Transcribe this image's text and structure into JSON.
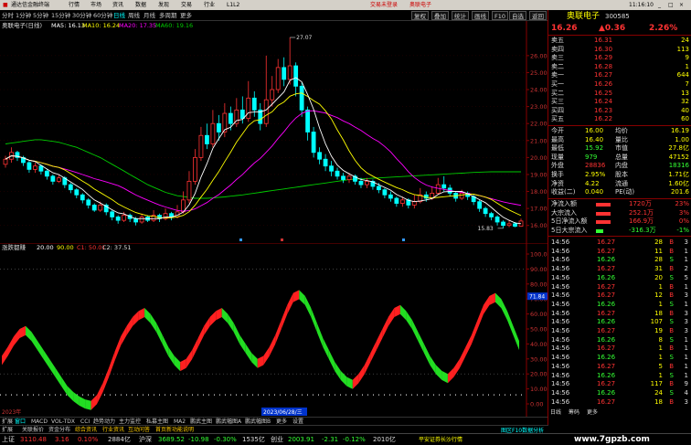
{
  "app": {
    "title": "通达信金融终端",
    "menus": [
      "行情",
      "市场",
      "资讯",
      "数据",
      "发现",
      "交易",
      "行业",
      "L1L2"
    ],
    "notice": "交易未登录",
    "stock_tag": "奥联电子",
    "clock": "11:16:10",
    "window_controls": [
      "_",
      "□",
      "×"
    ]
  },
  "toolbar": {
    "periods": [
      "分时",
      "1分钟",
      "5分钟",
      "15分钟",
      "30分钟",
      "60分钟",
      "日线",
      "周线",
      "月线",
      "多周期",
      "更多"
    ],
    "active_period": "日线",
    "buttons": [
      "复权",
      "叠加",
      "统计",
      "画线",
      "F10",
      "自选",
      "返回"
    ]
  },
  "main_legend": {
    "stock": "奥联电子(日线)",
    "ma5": "MA5: 16.13",
    "ma10": "MA10: 16.24",
    "ma20": "MA20: 17.35",
    "ma60": "MA60: 19.16"
  },
  "sub_legend": {
    "name": "涨跌都赚",
    "v1": "20.00",
    "v2": "90.00",
    "v3": "C1: 50.01",
    "v4": "C2: 37.51"
  },
  "price_axis": [
    "26.00",
    "25.00",
    "24.00",
    "23.00",
    "22.00",
    "21.00",
    "20.00",
    "19.00",
    "18.00",
    "17.00",
    "16.00"
  ],
  "ind_axis": [
    "100.00",
    "90.00",
    "80.00",
    "70.00",
    "60.00",
    "50.00",
    "40.00",
    "30.00",
    "20.00",
    "10.00",
    "0.00"
  ],
  "ind_axis_highlight": "71.84",
  "annotations": {
    "high": "27.07",
    "low": "15.83",
    "date_box": "2023/06/28/三",
    "year": "2023年"
  },
  "quote": {
    "price": "16.26",
    "change": "▲0.36",
    "pct": "2.26%",
    "name": "奥联电子",
    "code": "300585"
  },
  "orderbook": [
    {
      "label": "卖五",
      "price": "16.31",
      "vol": "24"
    },
    {
      "label": "卖四",
      "price": "16.30",
      "vol": "113"
    },
    {
      "label": "卖三",
      "price": "16.29",
      "vol": "9"
    },
    {
      "label": "卖二",
      "price": "16.28",
      "vol": "1"
    },
    {
      "label": "卖一",
      "price": "16.27",
      "vol": "644"
    },
    {
      "label": "买一",
      "price": "16.26",
      "vol": "7"
    },
    {
      "label": "买二",
      "price": "16.25",
      "vol": "13"
    },
    {
      "label": "买三",
      "price": "16.24",
      "vol": "32"
    },
    {
      "label": "买四",
      "price": "16.23",
      "vol": "40"
    },
    {
      "label": "买五",
      "price": "16.22",
      "vol": "60"
    }
  ],
  "stats": [
    {
      "l1": "今开",
      "v1": "16.00",
      "l2": "均价",
      "v2": "16.19"
    },
    {
      "l1": "最高",
      "v1": "16.40",
      "l2": "量比",
      "v2": "1.00"
    },
    {
      "l1": "最低",
      "v1": "15.92",
      "l2": "市值",
      "v2": "27.8亿"
    },
    {
      "l1": "现量",
      "v1": "979",
      "l2": "总量",
      "v2": "47152"
    },
    {
      "l1": "外盘",
      "v1": "28836",
      "l2": "内盘",
      "v2": "18316"
    },
    {
      "l1": "换手",
      "v1": "2.95%",
      "l2": "股本",
      "v2": "1.71亿"
    },
    {
      "l1": "净资",
      "v1": "4.22",
      "l2": "流通",
      "v2": "1.60亿"
    },
    {
      "l1": "收益(二)",
      "v1": "0.040",
      "l2": "PE(动)",
      "v2": "201.6"
    }
  ],
  "flows": [
    {
      "label": "净流入额",
      "value": "1720万",
      "pct": "23%"
    },
    {
      "label": "大宗流入",
      "value": "252.1万",
      "pct": "3%"
    },
    {
      "label": "5日净流入额",
      "value": "166.9万",
      "pct": "0%"
    },
    {
      "label": "5日大宗流入",
      "value": "-316.3万",
      "pct": "-1%"
    }
  ],
  "ticks": [
    {
      "t": "14:56",
      "p": "16.27",
      "v": "28",
      "s": "B",
      "n": "3"
    },
    {
      "t": "14:56",
      "p": "16.27",
      "v": "11",
      "s": "B",
      "n": "1"
    },
    {
      "t": "14:56",
      "p": "16.26",
      "v": "28",
      "s": "S",
      "n": "1"
    },
    {
      "t": "14:56",
      "p": "16.27",
      "v": "31",
      "s": "B",
      "n": "2"
    },
    {
      "t": "14:56",
      "p": "16.26",
      "v": "20",
      "s": "S",
      "n": "5"
    },
    {
      "t": "14:56",
      "p": "16.27",
      "v": "1",
      "s": "B",
      "n": "1"
    },
    {
      "t": "14:56",
      "p": "16.27",
      "v": "12",
      "s": "B",
      "n": "3"
    },
    {
      "t": "14:56",
      "p": "16.26",
      "v": "1",
      "s": "S",
      "n": "1"
    },
    {
      "t": "14:56",
      "p": "16.27",
      "v": "18",
      "s": "B",
      "n": "3"
    },
    {
      "t": "14:56",
      "p": "16.26",
      "v": "107",
      "s": "S",
      "n": "3"
    },
    {
      "t": "14:56",
      "p": "16.27",
      "v": "19",
      "s": "B",
      "n": "3"
    },
    {
      "t": "14:56",
      "p": "16.26",
      "v": "8",
      "s": "S",
      "n": "1"
    },
    {
      "t": "14:56",
      "p": "16.27",
      "v": "1",
      "s": "B",
      "n": "1"
    },
    {
      "t": "14:56",
      "p": "16.26",
      "v": "1",
      "s": "S",
      "n": "1"
    },
    {
      "t": "14:56",
      "p": "16.27",
      "v": "5",
      "s": "B",
      "n": "1"
    },
    {
      "t": "14:56",
      "p": "16.26",
      "v": "1",
      "s": "S",
      "n": "1"
    },
    {
      "t": "14:56",
      "p": "16.27",
      "v": "117",
      "s": "B",
      "n": "9"
    },
    {
      "t": "14:56",
      "p": "16.26",
      "v": "24",
      "s": "S",
      "n": "4"
    },
    {
      "t": "14:56",
      "p": "16.27",
      "v": "18",
      "s": "B",
      "n": "3"
    }
  ],
  "panel_tabs": [
    "日线",
    "筹码",
    "更多"
  ],
  "bottom_tabs": [
    "扩展",
    "窗口",
    "MACD",
    "VOL-TDX",
    "CCI",
    "趋势动力",
    "主力监控",
    "私募主图",
    "MA2",
    "鹏武主图",
    "鹏武幅图A",
    "鹏武幅图B",
    "更多",
    "设置"
  ],
  "bottom_tabs2": [
    "扩展",
    "关联报价",
    "资金分布",
    "综合资讯",
    "行业资讯",
    "互动问答",
    "首页新功能说明"
  ],
  "status": {
    "sh_label": "上证",
    "sh_val": "3110.48",
    "sh_chg": "3.16",
    "sh_pct": "0.10%",
    "sh_amt": "2884亿",
    "sz_label": "沪深",
    "sz_val": "3689.52",
    "sz_chg": "-10.98",
    "sz_pct": "-0.30%",
    "sz_amt": "1535亿",
    "cy_label": "创业",
    "cy_val": "2003.91",
    "cy_chg": "-2.31",
    "cy_pct": "-0.12%",
    "cy_amt": "2010亿",
    "msg": "平安证券长沙行情",
    "right": "图区F10数据分析"
  },
  "watermark": "www.7gpzb.com",
  "colors": {
    "up": "#ff3333",
    "down": "#33ff33",
    "ma5": "#ffffff",
    "ma10": "#ffff00",
    "ma20": "#ff00ff",
    "ma60": "#00cc00"
  },
  "chart_data": {
    "type": "candlestick",
    "candles": [
      [
        19.6,
        19.9,
        20.1,
        19.4
      ],
      [
        19.9,
        20.3,
        20.6,
        19.7
      ],
      [
        20.3,
        20.0,
        20.4,
        19.8
      ],
      [
        20.0,
        19.7,
        20.1,
        19.5
      ],
      [
        19.7,
        19.3,
        19.8,
        19.1
      ],
      [
        19.3,
        19.5,
        19.7,
        19.1
      ],
      [
        19.5,
        19.2,
        19.6,
        19.0
      ],
      [
        19.2,
        18.9,
        19.3,
        18.7
      ],
      [
        18.9,
        18.6,
        19.0,
        18.4
      ],
      [
        18.6,
        18.8,
        19.0,
        18.5
      ],
      [
        18.8,
        18.4,
        18.9,
        18.2
      ],
      [
        18.4,
        18.1,
        18.5,
        17.9
      ],
      [
        18.1,
        17.8,
        18.2,
        17.6
      ],
      [
        17.8,
        17.5,
        17.9,
        17.3
      ],
      [
        17.5,
        17.2,
        17.6,
        17.0
      ],
      [
        17.2,
        16.9,
        17.3,
        16.8
      ],
      [
        16.9,
        17.2,
        17.4,
        16.8
      ],
      [
        17.2,
        16.8,
        17.3,
        16.6
      ],
      [
        16.8,
        16.5,
        16.9,
        16.3
      ],
      [
        16.5,
        16.3,
        16.6,
        16.1
      ],
      [
        16.3,
        16.6,
        16.8,
        16.2
      ],
      [
        16.6,
        16.4,
        16.7,
        16.2
      ],
      [
        16.4,
        16.2,
        16.5,
        16.0
      ],
      [
        16.2,
        16.5,
        16.7,
        16.1
      ],
      [
        16.5,
        16.3,
        16.6,
        16.2
      ],
      [
        16.3,
        16.6,
        16.9,
        16.2
      ],
      [
        16.6,
        16.4,
        16.7,
        16.2
      ],
      [
        16.4,
        16.7,
        17.0,
        16.3
      ],
      [
        16.7,
        16.5,
        16.8,
        16.3
      ],
      [
        16.5,
        16.8,
        17.2,
        16.4
      ],
      [
        16.8,
        17.5,
        18.0,
        16.7
      ],
      [
        17.5,
        18.6,
        19.2,
        17.3
      ],
      [
        18.6,
        20.0,
        20.5,
        18.4
      ],
      [
        20.0,
        21.3,
        21.8,
        19.8
      ],
      [
        21.3,
        20.8,
        22.0,
        20.5
      ],
      [
        20.8,
        22.0,
        22.8,
        20.6
      ],
      [
        22.0,
        21.5,
        22.5,
        21.0
      ],
      [
        21.5,
        22.6,
        23.2,
        21.2
      ],
      [
        22.6,
        22.0,
        23.0,
        21.6
      ],
      [
        22.0,
        22.8,
        23.5,
        21.8
      ],
      [
        22.8,
        22.3,
        23.6,
        22.0
      ],
      [
        22.3,
        23.5,
        24.5,
        22.1
      ],
      [
        23.5,
        22.8,
        23.9,
        22.4
      ],
      [
        22.8,
        22.0,
        23.2,
        21.6
      ],
      [
        22.0,
        23.4,
        26.0,
        21.8
      ],
      [
        23.4,
        24.0,
        24.8,
        23.0
      ],
      [
        24.0,
        25.3,
        25.8,
        23.8
      ],
      [
        25.3,
        24.6,
        25.9,
        24.2
      ],
      [
        24.6,
        25.4,
        27.07,
        24.3
      ],
      [
        25.4,
        24.2,
        25.6,
        23.6
      ],
      [
        24.2,
        22.8,
        24.4,
        22.4
      ],
      [
        22.8,
        21.5,
        23.0,
        21.0
      ],
      [
        21.5,
        20.3,
        21.8,
        20.0
      ],
      [
        20.3,
        19.9,
        20.6,
        19.6
      ],
      [
        19.9,
        19.5,
        20.2,
        19.2
      ],
      [
        19.5,
        19.2,
        19.8,
        18.9
      ],
      [
        19.2,
        18.9,
        19.4,
        18.7
      ],
      [
        18.9,
        18.7,
        19.1,
        18.5
      ],
      [
        18.7,
        18.9,
        19.1,
        18.5
      ],
      [
        18.9,
        18.6,
        19.0,
        18.4
      ],
      [
        18.6,
        18.4,
        18.8,
        18.2
      ],
      [
        18.4,
        18.6,
        18.8,
        18.2
      ],
      [
        18.6,
        18.3,
        18.7,
        18.1
      ],
      [
        18.3,
        18.1,
        18.5,
        17.9
      ],
      [
        18.1,
        17.8,
        18.2,
        17.6
      ],
      [
        17.8,
        17.6,
        18.0,
        17.4
      ],
      [
        17.6,
        17.3,
        17.7,
        17.1
      ],
      [
        17.3,
        17.5,
        17.7,
        17.1
      ],
      [
        17.5,
        17.2,
        17.6,
        17.0
      ],
      [
        17.2,
        17.4,
        17.8,
        17.0
      ],
      [
        17.4,
        17.8,
        18.2,
        17.3
      ],
      [
        17.8,
        17.6,
        18.0,
        17.4
      ],
      [
        17.6,
        17.9,
        18.3,
        17.5
      ],
      [
        17.9,
        18.4,
        18.8,
        17.8
      ],
      [
        18.4,
        18.2,
        18.9,
        18.0
      ],
      [
        18.2,
        17.9,
        18.4,
        17.7
      ],
      [
        17.9,
        17.6,
        18.0,
        17.4
      ],
      [
        17.6,
        17.9,
        18.1,
        17.5
      ],
      [
        17.9,
        17.7,
        18.0,
        17.5
      ],
      [
        17.7,
        17.4,
        17.8,
        17.2
      ],
      [
        17.4,
        17.0,
        17.5,
        16.8
      ],
      [
        17.0,
        16.7,
        17.1,
        16.5
      ],
      [
        16.7,
        16.5,
        16.8,
        16.3
      ],
      [
        16.5,
        16.2,
        16.6,
        16.0
      ],
      [
        16.2,
        16.0,
        16.3,
        15.83
      ],
      [
        16.0,
        16.1,
        16.3,
        15.9
      ],
      [
        16.1,
        15.95,
        16.2,
        15.9
      ],
      [
        15.95,
        16.26,
        16.4,
        15.92
      ]
    ],
    "ma60": [
      20.8,
      20.85,
      20.9,
      20.95,
      21.0,
      21.05,
      21.05,
      21.0,
      20.95,
      20.9,
      20.8,
      20.7,
      20.6,
      20.45,
      20.3,
      20.15,
      20.0,
      19.8,
      19.6,
      19.4,
      19.2,
      19.0,
      18.8,
      18.6,
      18.4,
      18.25,
      18.1,
      17.95,
      17.85,
      17.75,
      17.7,
      17.65,
      17.6,
      17.6,
      17.6,
      17.62,
      17.65,
      17.68,
      17.72,
      17.76,
      17.8,
      17.85,
      17.9,
      17.95,
      18.0,
      18.05,
      18.1,
      18.15,
      18.2,
      18.25,
      18.3,
      18.35,
      18.4,
      18.45,
      18.5,
      18.55,
      18.6,
      18.65,
      18.7,
      18.72,
      18.74,
      18.76,
      18.78,
      18.8,
      18.82,
      18.84,
      18.86,
      18.88,
      18.9,
      18.92,
      18.94,
      18.96,
      18.98,
      19.0,
      19.02,
      19.04,
      19.06,
      19.08,
      19.1,
      19.12,
      19.14,
      19.15,
      19.16,
      19.16,
      19.16,
      19.16,
      19.16,
      19.16
    ],
    "indicator": [
      32,
      38,
      45,
      50,
      52,
      48,
      42,
      36,
      30,
      24,
      18,
      12,
      8,
      5,
      3,
      2,
      6,
      14,
      24,
      35,
      45,
      52,
      58,
      62,
      64,
      60,
      54,
      46,
      38,
      32,
      28,
      30,
      36,
      44,
      52,
      58,
      62,
      64,
      60,
      54,
      46,
      40,
      34,
      30,
      32,
      38,
      46,
      56,
      66,
      74,
      76,
      72,
      64,
      54,
      44,
      36,
      28,
      22,
      18,
      16,
      20,
      26,
      34,
      42,
      50,
      58,
      64,
      66,
      62,
      56,
      48,
      40,
      32,
      26,
      22,
      20,
      24,
      30,
      38,
      46,
      56,
      66,
      72,
      74,
      70,
      62,
      52,
      42
    ],
    "price_range": [
      15.5,
      27.5
    ],
    "ind_range": [
      0,
      100
    ]
  }
}
